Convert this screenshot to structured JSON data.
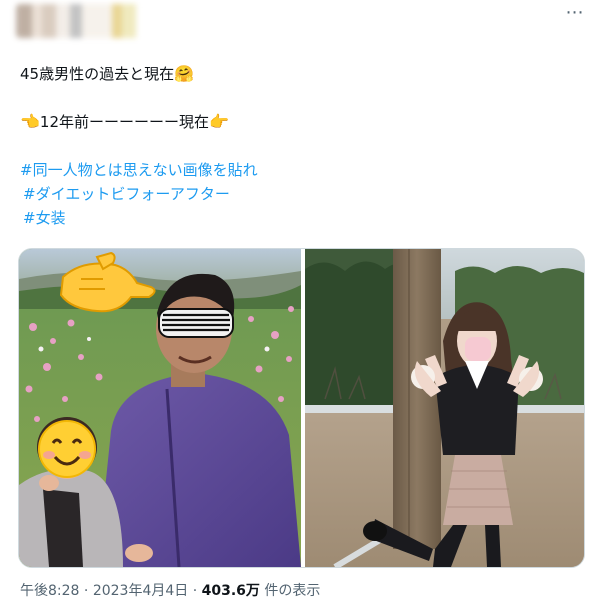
{
  "tweet": {
    "lines": [
      "45歳男性の過去と現在",
      "12年前ーーーーーー現在"
    ],
    "emoji_1": "🤗",
    "emoji_2": "👈",
    "emoji_3": "👉",
    "hashtags": [
      "#同一人物とは思えない画像を貼れ",
      "#ダイエットビフォーアフター",
      "#女装"
    ]
  },
  "header": {
    "more_icon": "⋯"
  },
  "media": {
    "left_icon": "photo-before",
    "right_icon": "photo-after"
  },
  "footer": {
    "time": "午後8:28",
    "sep1": " · ",
    "date": "2023年4月4日",
    "sep2": " · ",
    "views_count": "403.6万",
    "views_label": " 件の表示"
  },
  "colors": {
    "hashtag": "#1d9bf0",
    "text": "#0f1419",
    "muted": "#536471",
    "border": "#cfd9de"
  }
}
